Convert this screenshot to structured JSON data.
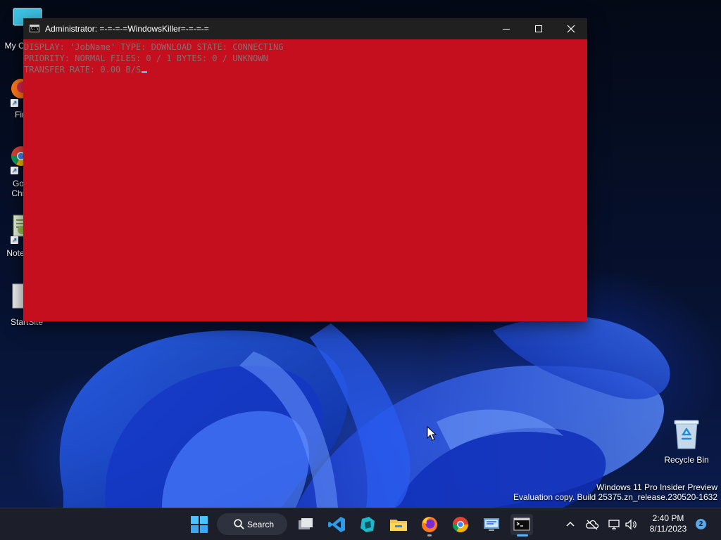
{
  "desktop": {
    "icons": [
      {
        "label": "My Co",
        "icon": "monitor-icon"
      },
      {
        "label": "Fir",
        "icon": "firefox-icon"
      },
      {
        "label": "Go\nChr",
        "icon": "chrome-icon"
      },
      {
        "label": "Note",
        "icon": "notepad-plus-icon"
      },
      {
        "label": "StartSite",
        "icon": "document-icon"
      }
    ],
    "recycle_bin": {
      "label": "Recycle Bin",
      "icon": "recycle-bin-icon"
    },
    "watermark": {
      "line1": "Windows 11 Pro Insider Preview",
      "line2": "Evaluation copy. Build 25375.zn_release.230520-1632"
    }
  },
  "window": {
    "title": "Administrator:  =-=-=-=WindowsKiller=-=-=-=",
    "icon": "cmd-icon",
    "background_color": "#c50f1f",
    "controls": {
      "minimize": "minimize-icon",
      "maximize": "maximize-icon",
      "close": "close-icon"
    },
    "console_lines": [
      "DISPLAY: 'JobName' TYPE: DOWNLOAD STATE: CONNECTING",
      "PRIORITY: NORMAL FILES: 0 / 1 BYTES: 0 / UNKNOWN",
      "TRANSFER RATE: 0.00 B/S"
    ]
  },
  "taskbar": {
    "search_label": "Search",
    "apps": [
      "start-icon",
      "task-view-icon",
      "vscode-icon",
      "edge-dev-icon",
      "file-explorer-icon",
      "firefox-icon",
      "chrome-icon",
      "remote-desktop-icon",
      "terminal-icon"
    ],
    "tray": [
      "chevron-up-icon",
      "onedrive-icon",
      "network-icon",
      "volume-icon"
    ],
    "clock": {
      "time": "2:40 PM",
      "date": "8/11/2023"
    },
    "notification_count": "2"
  }
}
